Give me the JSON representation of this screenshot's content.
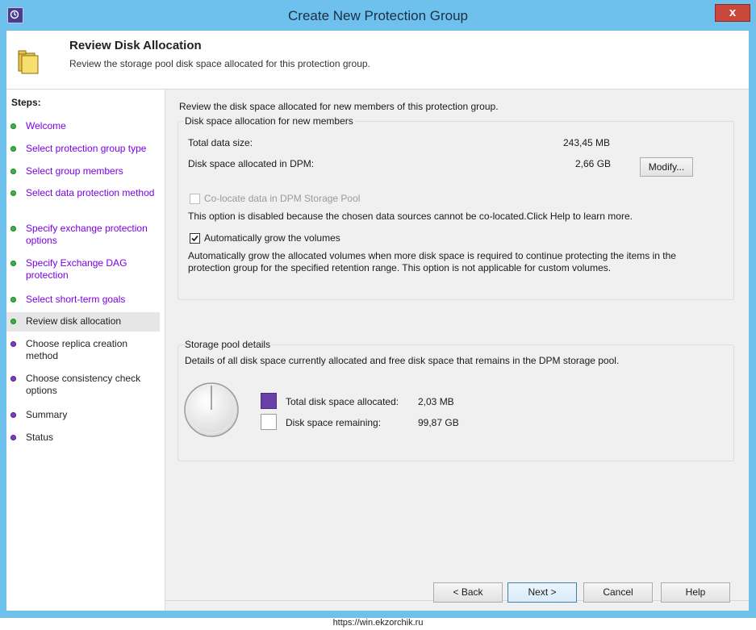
{
  "window": {
    "title": "Create New Protection Group",
    "close_glyph": "x"
  },
  "header": {
    "title": "Review Disk Allocation",
    "subtitle": "Review the storage pool disk space allocated for this protection group.",
    "icon": "folder-icon"
  },
  "steps": {
    "title": "Steps:",
    "items": [
      {
        "label": "Welcome",
        "status": "done"
      },
      {
        "label": "Select protection group type",
        "status": "done"
      },
      {
        "label": "Select group members",
        "status": "done"
      },
      {
        "label": "Select data protection method",
        "status": "done"
      },
      {
        "label": "Specify exchange protection options",
        "status": "done"
      },
      {
        "label": "Specify Exchange DAG protection",
        "status": "done"
      },
      {
        "label": "Select short-term goals",
        "status": "done"
      },
      {
        "label": "Review disk allocation",
        "status": "current"
      },
      {
        "label": "Choose replica creation method",
        "status": "pending"
      },
      {
        "label": "Choose consistency check options",
        "status": "pending"
      },
      {
        "label": "Summary",
        "status": "pending"
      },
      {
        "label": "Status",
        "status": "pending"
      }
    ]
  },
  "main": {
    "intro": "Review the disk space allocated for new members of this protection group.",
    "allocation": {
      "group_title": "Disk space allocation for new members",
      "total_data_label": "Total data size:",
      "total_data_value": "243,45 MB",
      "allocated_label": "Disk space allocated in DPM:",
      "allocated_value": "2,66 GB",
      "modify_button": "Modify...",
      "colocate_label": "Co-locate data in DPM Storage Pool",
      "colocate_checked": false,
      "colocate_note": "This option is disabled because the chosen data sources cannot be co-located.Click Help to learn more.",
      "autogrow_label": "Automatically grow the volumes",
      "autogrow_checked": true,
      "autogrow_note": "Automatically grow the allocated volumes when more disk space is required to continue protecting the items in the protection group for the specified retention range. This option is not applicable for custom volumes."
    },
    "pool": {
      "group_title": "Storage pool details",
      "description": "Details of all disk space currently allocated and free disk space that remains in the DPM storage pool.",
      "allocated_label": "Total disk space allocated:",
      "allocated_value": "2,03 MB",
      "allocated_color": "#6a3fa8",
      "remaining_label": "Disk space remaining:",
      "remaining_value": "99,87 GB",
      "remaining_color": "#ffffff"
    }
  },
  "buttons": {
    "back": "< Back",
    "next": "Next >",
    "cancel": "Cancel",
    "help": "Help"
  },
  "watermark": "https://win.ekzorchik.ru"
}
